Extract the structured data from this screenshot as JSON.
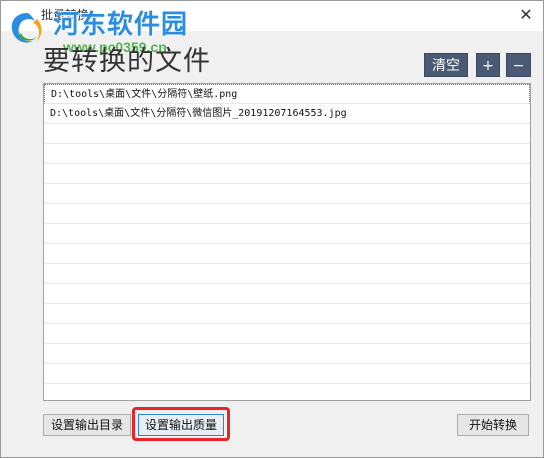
{
  "window": {
    "title": "批量转换",
    "close_glyph": "✕"
  },
  "watermark": {
    "site_name": "河东软件园",
    "url": "www.pc0359.cn",
    "logo_icon": "swirl-logo-icon"
  },
  "header": {
    "title": "要转换的文件"
  },
  "toolbar": {
    "clear_label": "清空",
    "add_label": "+",
    "remove_label": "−"
  },
  "files": [
    "D:\\tools\\桌面\\文件\\分隔符\\壁纸.png",
    "D:\\tools\\桌面\\文件\\分隔符\\微信图片_20191207164553.jpg",
    "",
    "",
    "",
    "",
    "",
    "",
    "",
    "",
    "",
    "",
    "",
    "",
    "",
    ""
  ],
  "footer": {
    "set_output_dir_label": "设置输出目录",
    "set_output_quality_label": "设置输出质量",
    "start_convert_label": "开始转换"
  },
  "colors": {
    "dark_button": "#4a5a75",
    "highlight": "#e8242a",
    "watermark_blue": "#2b8de0",
    "watermark_green": "#3aa83a"
  }
}
